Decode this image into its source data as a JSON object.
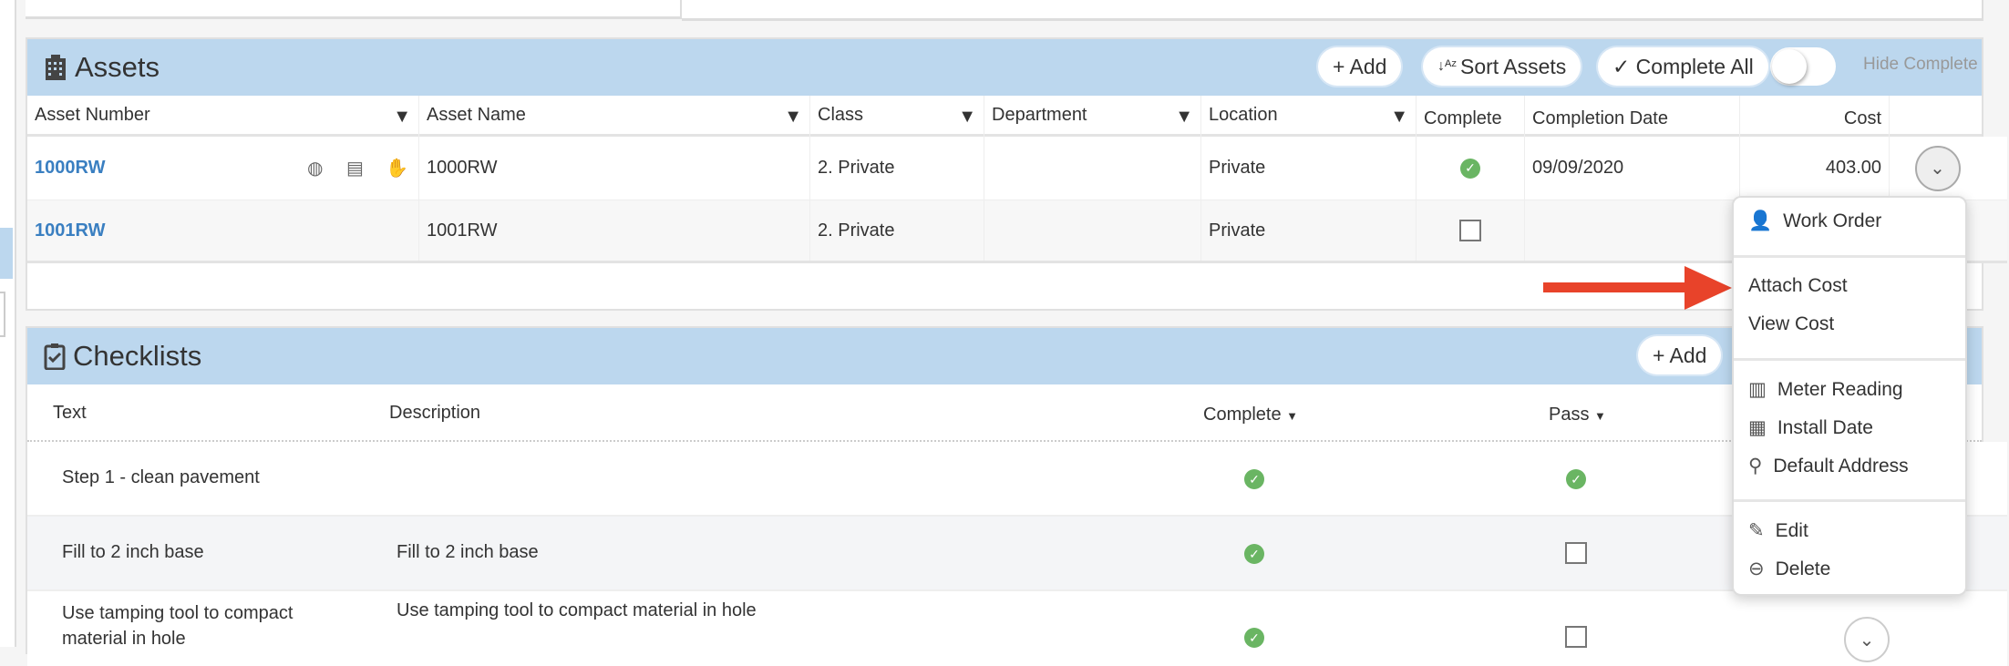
{
  "assets": {
    "title": "Assets",
    "add_label": "+ Add",
    "sort_label": "Sort Assets",
    "complete_all_label": "✓ Complete All",
    "hide_complete_label": "Hide Complete",
    "hide_complete_on": false,
    "columns": [
      "Asset Number",
      "Asset Name",
      "Class",
      "Department",
      "Location",
      "Complete",
      "Completion Date",
      "Cost"
    ],
    "rows": [
      {
        "number": "1000RW",
        "name": "1000RW",
        "class": "2. Private",
        "department": "",
        "location": "Private",
        "complete": true,
        "completion_date": "09/09/2020",
        "cost": "403.00"
      },
      {
        "number": "1001RW",
        "name": "1001RW",
        "class": "2. Private",
        "department": "",
        "location": "Private",
        "complete": false,
        "completion_date": "",
        "cost": ""
      }
    ]
  },
  "menu": {
    "items": [
      "Work Order",
      "Attach Cost",
      "View Cost",
      "Meter Reading",
      "Install Date",
      "Default Address",
      "Edit",
      "Delete"
    ]
  },
  "checklists": {
    "title": "Checklists",
    "add_label": "+ Add",
    "columns": [
      "Text",
      "Description",
      "Complete",
      "Pass"
    ],
    "rows": [
      {
        "text": "Step 1 - clean pavement",
        "description": "",
        "complete": true,
        "pass": true
      },
      {
        "text": "Fill to 2 inch base",
        "description": "Fill to 2 inch base",
        "complete": true,
        "pass": false
      },
      {
        "text": "Use tamping tool to compact material in hole",
        "description": "Use tamping tool to compact material in hole",
        "complete": true,
        "pass": false
      }
    ]
  },
  "colors": {
    "header_bar": "#bcd7ee",
    "link": "#3a7fc1",
    "check": "#6ab563",
    "arrow": "#e8432a"
  }
}
